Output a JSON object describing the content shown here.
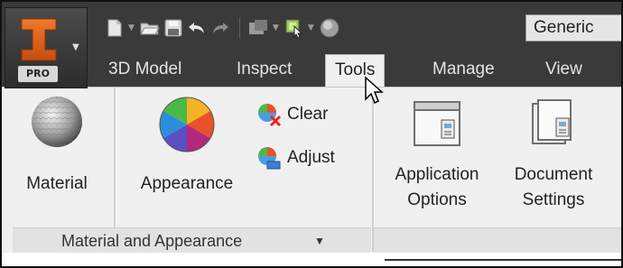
{
  "app": {
    "name": "Autodesk Inventor Professional",
    "badge": "PRO",
    "logo_icon": "inventor-logo-icon"
  },
  "quick_access": {
    "icons": [
      "new-file-icon",
      "open-folder-icon",
      "save-icon",
      "undo-icon",
      "redo-icon",
      "update-icon",
      "select-icon",
      "material-sphere-icon"
    ],
    "appearance_value": "Generic"
  },
  "tabs": [
    {
      "label": "3D Model",
      "active": false
    },
    {
      "label": "Inspect",
      "active": false
    },
    {
      "label": "Tools",
      "active": true
    },
    {
      "label": "Manage",
      "active": false
    },
    {
      "label": "View",
      "active": false
    }
  ],
  "ribbon": {
    "material_panel": {
      "title": "Material and Appearance",
      "material_label": "Material",
      "appearance_label": "Appearance",
      "clear_label": "Clear",
      "adjust_label": "Adjust"
    },
    "options_panel": {
      "app_options_line1": "Application",
      "app_options_line2": "Options",
      "doc_settings_line1": "Document",
      "doc_settings_line2": "Settings"
    }
  },
  "colors": {
    "titlebar": "#3a3a3a",
    "ribbon": "#f0f0f0",
    "logo_orange": "#e2601c"
  }
}
